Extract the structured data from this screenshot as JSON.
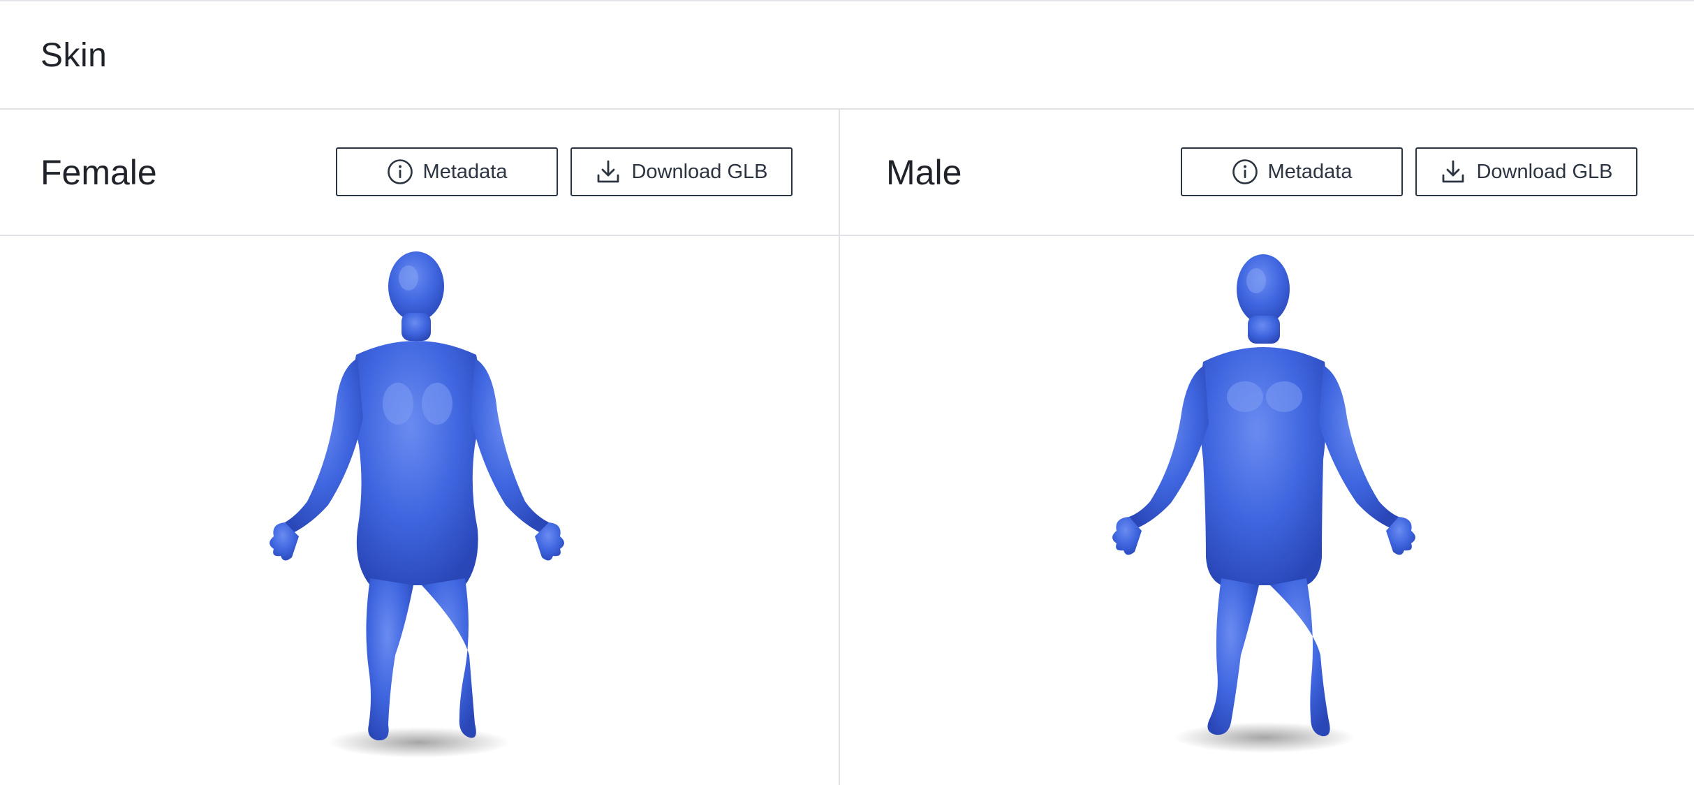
{
  "section": {
    "title": "Skin"
  },
  "panels": [
    {
      "title": "Female",
      "metadata_label": "Metadata",
      "download_label": "Download GLB"
    },
    {
      "title": "Male",
      "metadata_label": "Metadata",
      "download_label": "Download GLB"
    }
  ],
  "colors": {
    "model_blue": "#3f66e0",
    "model_highlight": "#6a8bf0",
    "model_shadow": "#2a47b8",
    "border": "#dfe1e4",
    "button_border": "#2b3440"
  },
  "icons": {
    "metadata": "info-circle-icon",
    "download": "download-icon"
  }
}
